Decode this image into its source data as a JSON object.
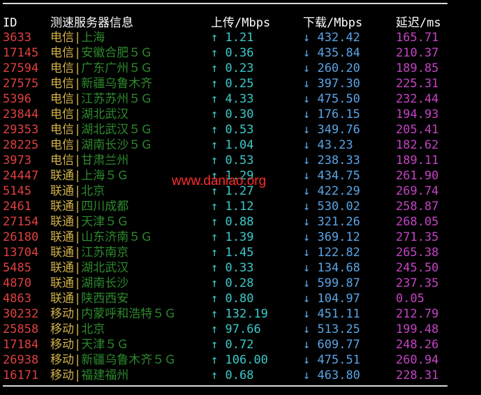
{
  "header": {
    "id": "ID",
    "server": "测速服务器信息",
    "upload": "上传/Mbps",
    "download": "下载/Mbps",
    "latency": "延迟/ms"
  },
  "watermark": "www.daniao.org",
  "arrows": {
    "up": "↑",
    "down": "↓"
  },
  "separator": "|",
  "colors": {
    "id": "#e0403f",
    "isp": "#d2b24a",
    "location": "#2d8a2d",
    "upload": "#3cc9c9",
    "download": "#5aa4e6",
    "latency": "#c443c4",
    "watermark": "#ff2a2a",
    "background": "#000000"
  },
  "rows": [
    {
      "id": "3633",
      "isp": "电信",
      "location": "上海",
      "upload": "1.21",
      "download": "432.42",
      "latency": "165.71"
    },
    {
      "id": "17145",
      "isp": "电信",
      "location": "安徽合肥５Ｇ",
      "upload": "0.36",
      "download": "435.84",
      "latency": "210.37"
    },
    {
      "id": "27594",
      "isp": "电信",
      "location": "广东广州５Ｇ",
      "upload": "0.23",
      "download": "260.20",
      "latency": "189.85"
    },
    {
      "id": "27575",
      "isp": "电信",
      "location": "新疆乌鲁木齐",
      "upload": "0.25",
      "download": "397.30",
      "latency": "225.31"
    },
    {
      "id": "5396",
      "isp": "电信",
      "location": "江苏苏州５Ｇ",
      "upload": "4.33",
      "download": "475.50",
      "latency": "232.44"
    },
    {
      "id": "23844",
      "isp": "电信",
      "location": "湖北武汉",
      "upload": "0.30",
      "download": "176.15",
      "latency": "194.93"
    },
    {
      "id": "29353",
      "isp": "电信",
      "location": "湖北武汉５Ｇ",
      "upload": "0.53",
      "download": "349.76",
      "latency": "205.41"
    },
    {
      "id": "28225",
      "isp": "电信",
      "location": "湖南长沙５Ｇ",
      "upload": "1.04",
      "download": "43.23",
      "latency": "182.62"
    },
    {
      "id": "3973",
      "isp": "电信",
      "location": "甘肃兰州",
      "upload": "0.53",
      "download": "238.33",
      "latency": "189.11"
    },
    {
      "id": "24447",
      "isp": "联通",
      "location": "上海５Ｇ",
      "upload": "1.29",
      "download": "434.75",
      "latency": "261.90"
    },
    {
      "id": "5145",
      "isp": "联通",
      "location": "北京",
      "upload": "1.27",
      "download": "422.29",
      "latency": "269.74"
    },
    {
      "id": "2461",
      "isp": "联通",
      "location": "四川成都",
      "upload": "1.12",
      "download": "530.02",
      "latency": "258.87"
    },
    {
      "id": "27154",
      "isp": "联通",
      "location": "天津５Ｇ",
      "upload": "0.88",
      "download": "321.26",
      "latency": "268.05"
    },
    {
      "id": "26180",
      "isp": "联通",
      "location": "山东济南５Ｇ",
      "upload": "1.39",
      "download": "369.12",
      "latency": "271.35"
    },
    {
      "id": "13704",
      "isp": "联通",
      "location": "江苏南京",
      "upload": "1.45",
      "download": "122.82",
      "latency": "265.38"
    },
    {
      "id": "5485",
      "isp": "联通",
      "location": "湖北武汉",
      "upload": "0.33",
      "download": "134.68",
      "latency": "245.50"
    },
    {
      "id": "4870",
      "isp": "联通",
      "location": "湖南长沙",
      "upload": "0.28",
      "download": "599.87",
      "latency": "237.35"
    },
    {
      "id": "4863",
      "isp": "联通",
      "location": "陕西西安",
      "upload": "0.80",
      "download": "104.97",
      "latency": "0.05"
    },
    {
      "id": "30232",
      "isp": "移动",
      "location": "内蒙呼和浩特５Ｇ",
      "upload": "132.19",
      "download": "451.11",
      "latency": "212.79"
    },
    {
      "id": "25858",
      "isp": "移动",
      "location": "北京",
      "upload": "97.66",
      "download": "513.25",
      "latency": "199.48"
    },
    {
      "id": "17184",
      "isp": "移动",
      "location": "天津５Ｇ",
      "upload": "0.72",
      "download": "609.77",
      "latency": "248.26"
    },
    {
      "id": "26938",
      "isp": "移动",
      "location": "新疆乌鲁木齐５Ｇ",
      "upload": "106.00",
      "download": "475.51",
      "latency": "260.94"
    },
    {
      "id": "16171",
      "isp": "移动",
      "location": "福建福州",
      "upload": "0.68",
      "download": "463.80",
      "latency": "228.31"
    }
  ]
}
